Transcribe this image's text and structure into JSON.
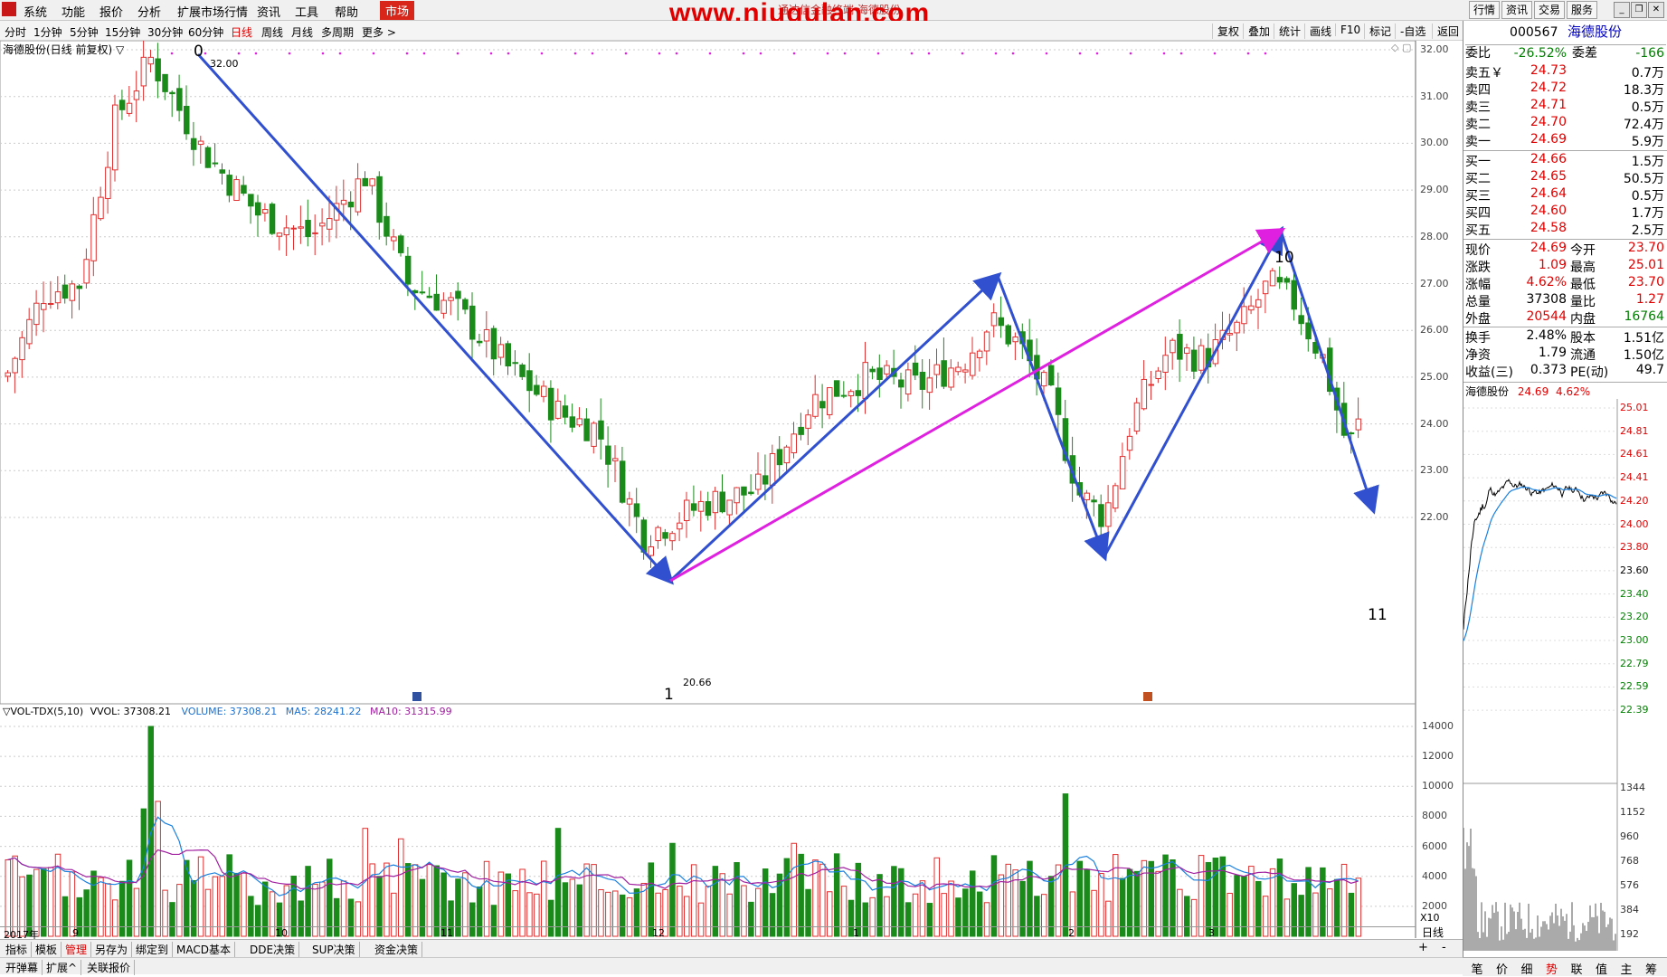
{
  "menu": {
    "items": [
      "系统",
      "功能",
      "报价",
      "分析",
      "扩展市场行情",
      "资讯",
      "工具",
      "帮助"
    ],
    "market": "市场",
    "watermark": "www.niugulan.com",
    "subtitle": "通达信金融终端 海德股份",
    "right_buttons": [
      "行情",
      "资讯",
      "交易",
      "服务"
    ]
  },
  "periods": {
    "items": [
      "分时",
      "1分钟",
      "5分钟",
      "15分钟",
      "30分钟",
      "60分钟",
      "日线",
      "周线",
      "月线",
      "多周期",
      "更多 >"
    ],
    "active": "日线"
  },
  "toolbar": [
    "复权",
    "叠加",
    "统计",
    "画线",
    "F10",
    "标记",
    "-自选",
    "返回"
  ],
  "chart": {
    "title": "海德股份(日线 前复权) ▽",
    "high_label": "32.00",
    "low_label": "20.66",
    "wave_labels": [
      "0",
      "1",
      "10",
      "11"
    ],
    "y_ticks": [
      "32.00",
      "31.00",
      "30.00",
      "29.00",
      "28.00",
      "27.00",
      "26.00",
      "25.00",
      "24.00",
      "23.00",
      "22.00"
    ],
    "x_labels": [
      "2017年",
      "9",
      "10",
      "11",
      "12",
      "1",
      "2",
      "3"
    ],
    "colors": {
      "up": "#e03030",
      "down": "#1a8a1a",
      "wave": "#3050d0",
      "trend": "#e020e0",
      "grid": "#cccccc"
    }
  },
  "volume": {
    "indicator": "▽VOL-TDX(5,10)",
    "vvol": "VVOL: 37308.21",
    "volume": "VOLUME: 37308.21",
    "ma5": "MA5: 28241.22",
    "ma10": "MA10: 31315.99",
    "y_ticks": [
      "14000",
      "12000",
      "10000",
      "8000",
      "6000",
      "4000",
      "2000"
    ],
    "unit": "X10"
  },
  "quote": {
    "code": "000567",
    "name": "海德股份",
    "weibi_label": "委比",
    "weibi_value": "-26.52%",
    "weicha_label": "委差",
    "weicha_value": "-166",
    "asks": [
      {
        "label": "卖五￥",
        "price": "24.73",
        "vol": "0.7万"
      },
      {
        "label": "卖四",
        "price": "24.72",
        "vol": "18.3万"
      },
      {
        "label": "卖三",
        "price": "24.71",
        "vol": "0.5万"
      },
      {
        "label": "卖二",
        "price": "24.70",
        "vol": "72.4万"
      },
      {
        "label": "卖一",
        "price": "24.69",
        "vol": "5.9万"
      }
    ],
    "bids": [
      {
        "label": "买一",
        "price": "24.66",
        "vol": "1.5万"
      },
      {
        "label": "买二",
        "price": "24.65",
        "vol": "50.5万"
      },
      {
        "label": "买三",
        "price": "24.64",
        "vol": "0.5万"
      },
      {
        "label": "买四",
        "price": "24.60",
        "vol": "1.7万"
      },
      {
        "label": "买五",
        "price": "24.58",
        "vol": "2.5万"
      }
    ],
    "stats": [
      {
        "l1": "现价",
        "v1": "24.69",
        "l2": "今开",
        "v2": "23.70",
        "c1": "red",
        "c2": "red"
      },
      {
        "l1": "涨跌",
        "v1": "1.09",
        "l2": "最高",
        "v2": "25.01",
        "c1": "red",
        "c2": "red"
      },
      {
        "l1": "涨幅",
        "v1": "4.62%",
        "l2": "最低",
        "v2": "23.70",
        "c1": "red",
        "c2": "red"
      },
      {
        "l1": "总量",
        "v1": "37308",
        "l2": "量比",
        "v2": "1.27",
        "c1": "black",
        "c2": "red"
      },
      {
        "l1": "外盘",
        "v1": "20544",
        "l2": "内盘",
        "v2": "16764",
        "c1": "red",
        "c2": "green"
      }
    ],
    "stats2": [
      {
        "l1": "换手",
        "v1": "2.48%",
        "l2": "股本",
        "v2": "1.51亿"
      },
      {
        "l1": "净资",
        "v1": "1.79",
        "l2": "流通",
        "v2": "1.50亿"
      },
      {
        "l1": "收益(三)",
        "v1": "0.373",
        "l2": "PE(动)",
        "v2": "49.7"
      }
    ],
    "mini_title": "海德股份",
    "mini_price": "24.69",
    "mini_pct": "4.62%",
    "mini_ticks": [
      "25.01",
      "24.81",
      "24.61",
      "24.41",
      "24.20",
      "24.00",
      "23.80",
      "23.60",
      "23.40",
      "23.20",
      "23.00",
      "22.79",
      "22.59",
      "22.39"
    ],
    "mini_vol_ticks": [
      "1344",
      "1152",
      "960",
      "768",
      "576",
      "384",
      "192"
    ]
  },
  "bottom": {
    "tabs1": [
      "指标",
      "模板",
      "管理",
      "另存为",
      "绑定到",
      "MACD基本",
      "DDE决策",
      "SUP决策",
      "资金决策"
    ],
    "tabs2": [
      "开弹幕",
      "扩展^",
      "关联报价"
    ],
    "right_label": "日线",
    "right_tabs": [
      "笔",
      "价",
      "细",
      "势",
      "联",
      "值",
      "主",
      "筹"
    ]
  }
}
